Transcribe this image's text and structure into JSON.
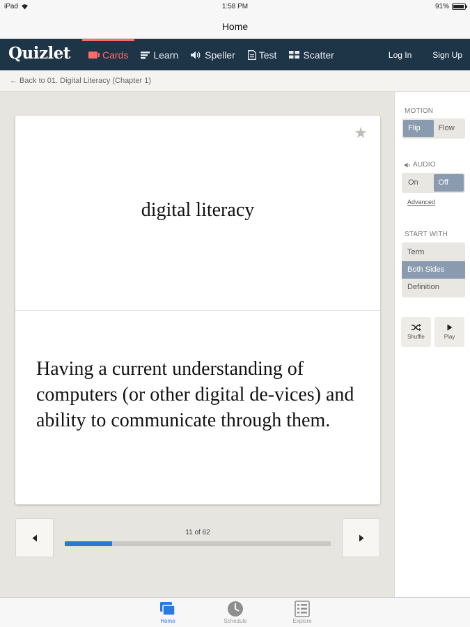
{
  "status_bar": {
    "device": "iPad",
    "time": "1:58 PM",
    "battery": "91%",
    "battery_level": 0.91
  },
  "nav": {
    "title": "Home"
  },
  "header": {
    "logo": "Quizlet",
    "modes": [
      {
        "label": "Cards",
        "icon": "cards-icon",
        "active": true
      },
      {
        "label": "Learn",
        "icon": "learn-icon"
      },
      {
        "label": "Speller",
        "icon": "speaker-icon"
      },
      {
        "label": "Test",
        "icon": "test-icon"
      },
      {
        "label": "Scatter",
        "icon": "scatter-icon"
      }
    ],
    "login": "Log In",
    "signup": "Sign Up"
  },
  "breadcrumb": {
    "text": "← Back to 01. Digital Literacy (Chapter 1)"
  },
  "card": {
    "term": "digital literacy",
    "definition": "Having a current understanding of computers (or other digital de-vices) and ability to communicate through them."
  },
  "progress": {
    "counter": "11 of 62",
    "current": 11,
    "total": 62
  },
  "sidebar": {
    "motion": {
      "label": "MOTION",
      "options": [
        "Flip",
        "Flow"
      ],
      "selected": "Flip"
    },
    "audio": {
      "label": "AUDIO",
      "options": [
        "On",
        "Off"
      ],
      "selected": "Off",
      "advanced": "Advanced"
    },
    "start_with": {
      "label": "START WITH",
      "options": [
        "Term",
        "Both Sides",
        "Definition"
      ],
      "selected": "Both Sides"
    },
    "shuffle": "Shuffle",
    "play": "Play"
  },
  "tabs": [
    {
      "label": "Home",
      "icon": "home-cards-icon",
      "active": true
    },
    {
      "label": "Schedule",
      "icon": "schedule-icon"
    },
    {
      "label": "Explore",
      "icon": "explore-icon"
    }
  ],
  "colors": {
    "header_bg": "#1e3447",
    "active_mode": "#ff6b6b",
    "progress_fill": "#2a79d4",
    "selected_option": "#8a9bb0",
    "tab_active": "#2a7ae2"
  }
}
